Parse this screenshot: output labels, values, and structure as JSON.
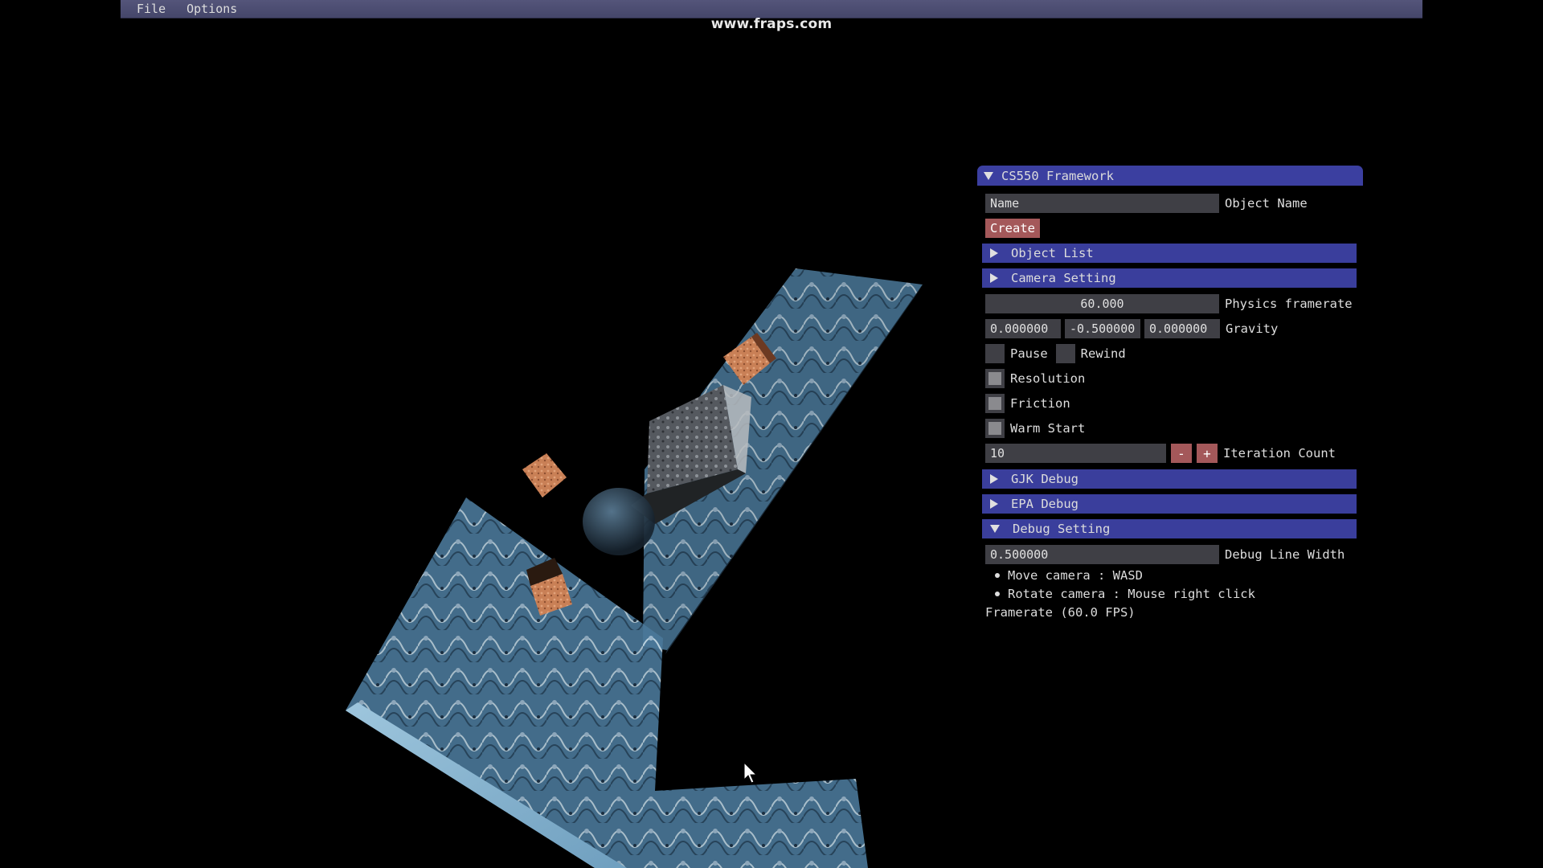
{
  "menubar": {
    "items": [
      "File",
      "Options"
    ]
  },
  "watermark": "www.fraps.com",
  "panel": {
    "title": "CS550 Framework",
    "name_input": {
      "value": "Name",
      "label": "Object Name"
    },
    "create_label": "Create",
    "object_list": "Object List",
    "camera_setting": "Camera Setting",
    "physics_framerate": {
      "value": "60.000",
      "label": "Physics framerate"
    },
    "gravity": {
      "x": "0.000000",
      "y": "-0.500000",
      "z": "0.000000",
      "label": "Gravity"
    },
    "pause_label": "Pause",
    "rewind_label": "Rewind",
    "resolution_label": "Resolution",
    "friction_label": "Friction",
    "warm_start_label": "Warm Start",
    "iteration": {
      "value": "10",
      "minus": "-",
      "plus": "+",
      "label": "Iteration Count"
    },
    "gjk_debug": "GJK Debug",
    "epa_debug": "EPA Debug",
    "debug_setting": "Debug Setting",
    "debug_line_width": {
      "value": "0.500000",
      "label": "Debug Line Width"
    },
    "help": [
      "Move camera : WASD",
      "Rotate camera : Mouse right click"
    ],
    "framerate_text": "Framerate (60.0 FPS)"
  },
  "colors": {
    "header": "#3a3e9c",
    "title": "#3b3fa0",
    "button": "#a4585a",
    "field": "#3f3f45"
  },
  "icons": {
    "collapse": "triangle-down-icon",
    "expand": "triangle-right-icon",
    "cursor": "mouse-pointer-icon"
  }
}
